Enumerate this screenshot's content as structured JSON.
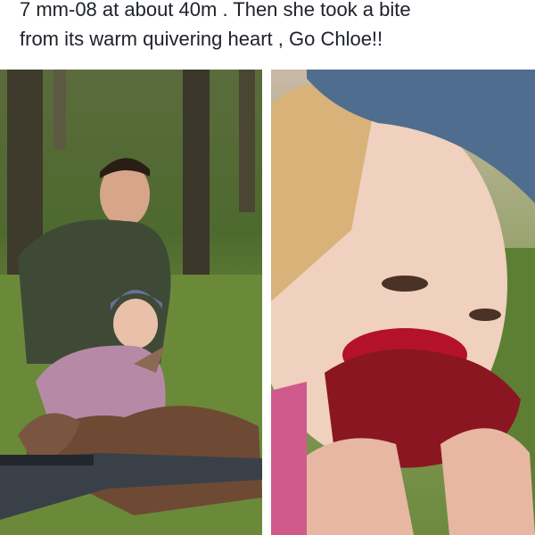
{
  "post": {
    "caption_line1": "7 mm-08 at about 40m . Then she took a bite",
    "caption_line2": "from its warm quivering heart , Go Chloe!!"
  },
  "photos": {
    "left_alt": "Man and young girl posing behind a hunted deer with a rifle in the foreground",
    "right_alt": "Young girl in a knit hat biting into a raw bloody heart"
  },
  "colors": {
    "text": "#1d2129",
    "forest": "#4d6a2e",
    "blood": "#b3122a"
  }
}
